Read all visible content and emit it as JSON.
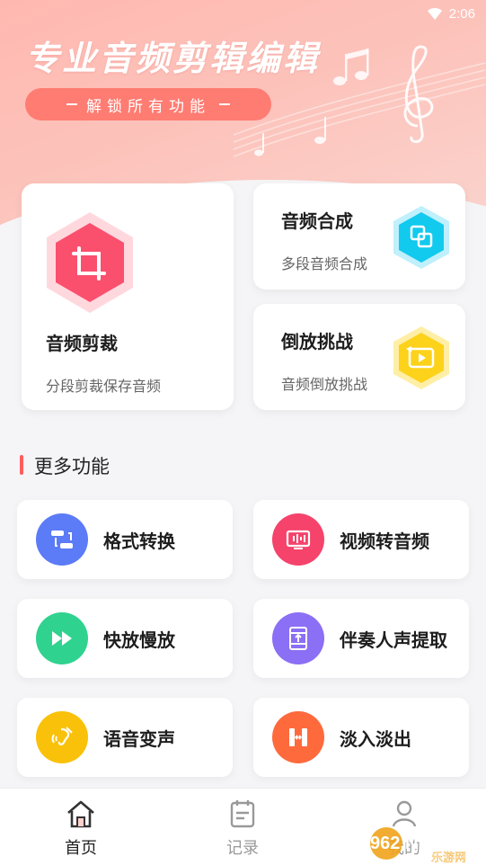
{
  "status_bar": {
    "time": "2:06"
  },
  "hero": {
    "title": "专业音频剪辑编辑",
    "subtitle": "解锁所有功能"
  },
  "cards": {
    "crop": {
      "title": "音频剪裁",
      "subtitle": "分段剪裁保存音频"
    },
    "merge": {
      "title": "音频合成",
      "subtitle": "多段音频合成"
    },
    "reverse": {
      "title": "倒放挑战",
      "subtitle": "音频倒放挑战"
    }
  },
  "section": {
    "title": "更多功能"
  },
  "features": [
    {
      "label": "格式转换",
      "icon": "format-convert-icon",
      "color": "#5b7bf7"
    },
    {
      "label": "视频转音频",
      "icon": "video-to-audio-icon",
      "color": "#f5436b"
    },
    {
      "label": "快放慢放",
      "icon": "fast-forward-icon",
      "color": "#2fd38f"
    },
    {
      "label": "伴奏人声提取",
      "icon": "film-extract-icon",
      "color": "#8b6ff5"
    },
    {
      "label": "语音变声",
      "icon": "voice-change-icon",
      "color": "#f9c10a"
    },
    {
      "label": "淡入淡出",
      "icon": "fade-icon",
      "color": "#ff6a3d"
    }
  ],
  "bottom_nav": [
    {
      "label": "首页",
      "active": true
    },
    {
      "label": "记录",
      "active": false
    },
    {
      "label": "我的",
      "active": false
    }
  ],
  "watermark": {
    "text": "962.NET",
    "subtext": "乐游网"
  },
  "colors": {
    "accent": "#ff5d5d",
    "hero_pill": "#ff7c72"
  }
}
